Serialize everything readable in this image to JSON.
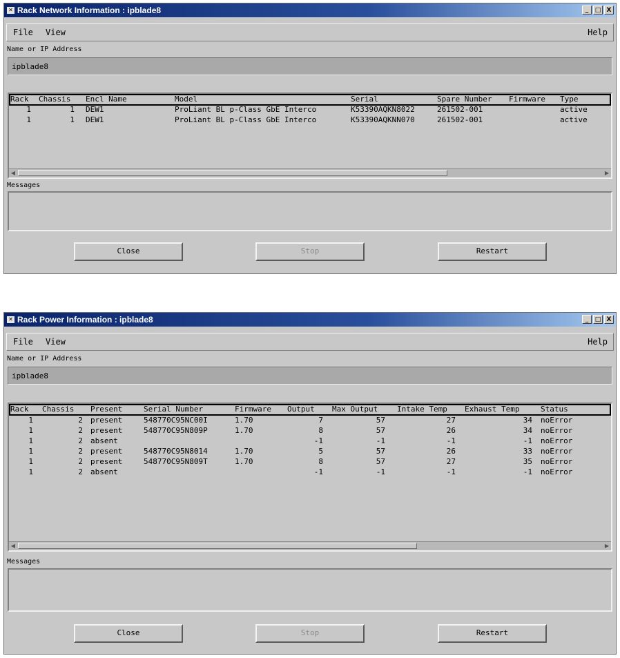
{
  "network": {
    "title": "Rack Network Information : ipblade8",
    "menu": {
      "file": "File",
      "view": "View",
      "help": "Help"
    },
    "address_label": "Name or IP Address",
    "address_value": "ipblade8",
    "columns": [
      "Rack",
      "Chassis",
      "Encl Name",
      "Model",
      "Serial",
      "Spare Number",
      "Firmware",
      "Type"
    ],
    "rows": [
      [
        "1",
        "1",
        "DEW1",
        "ProLiant BL p-Class GbE Interco",
        "K53390AQKN8022",
        "261502-001",
        "",
        "active"
      ],
      [
        "1",
        "1",
        "DEW1",
        "ProLiant BL p-Class GbE Interco",
        "K53390AQKNN070",
        "261502-001",
        "",
        "active"
      ]
    ],
    "messages_label": "Messages",
    "buttons": {
      "close": "Close",
      "stop": "Stop",
      "restart": "Restart"
    }
  },
  "power": {
    "title": "Rack Power Information : ipblade8",
    "menu": {
      "file": "File",
      "view": "View",
      "help": "Help"
    },
    "address_label": "Name or IP Address",
    "address_value": "ipblade8",
    "columns": [
      "Rack",
      "Chassis",
      "Present",
      "Serial Number",
      "Firmware",
      "Output",
      "Max Output",
      "Intake Temp",
      "Exhaust Temp",
      "Status"
    ],
    "rows": [
      [
        "1",
        "2",
        "present",
        "548770C95NC00I",
        "1.70",
        "7",
        "57",
        "27",
        "34",
        "noError"
      ],
      [
        "1",
        "2",
        "present",
        "548770C95N809P",
        "1.70",
        "8",
        "57",
        "26",
        "34",
        "noError"
      ],
      [
        "1",
        "2",
        "absent",
        "",
        "",
        "-1",
        "-1",
        "-1",
        "-1",
        "noError"
      ],
      [
        "1",
        "2",
        "present",
        "548770C95N8014",
        "1.70",
        "5",
        "57",
        "26",
        "33",
        "noError"
      ],
      [
        "1",
        "2",
        "present",
        "548770C95N809T",
        "1.70",
        "8",
        "57",
        "27",
        "35",
        "noError"
      ],
      [
        "1",
        "2",
        "absent",
        "",
        "",
        "-1",
        "-1",
        "-1",
        "-1",
        "noError"
      ]
    ],
    "messages_label": "Messages",
    "buttons": {
      "close": "Close",
      "stop": "Stop",
      "restart": "Restart"
    }
  },
  "titlebar_buttons": {
    "minimize": "_",
    "maximize": "□",
    "close": "X"
  }
}
